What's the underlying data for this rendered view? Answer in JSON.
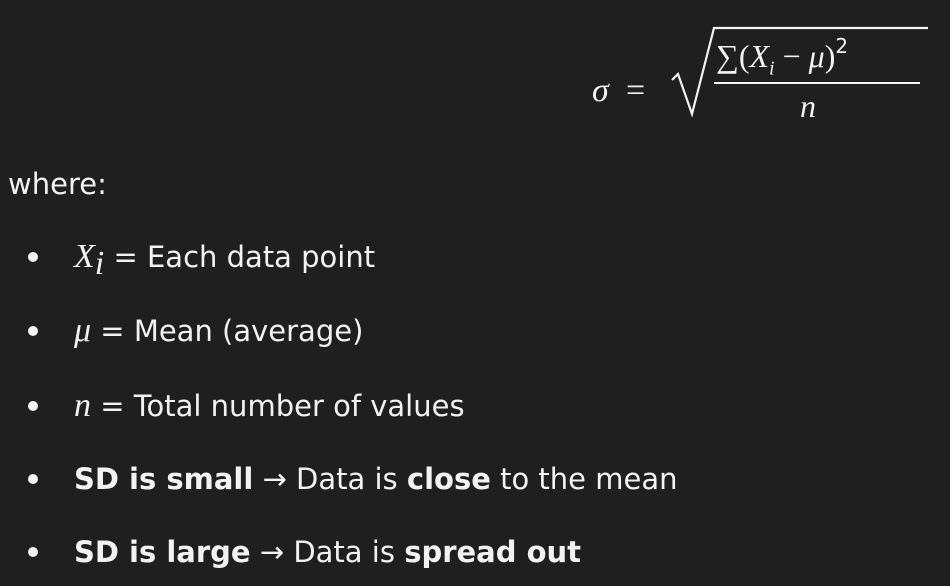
{
  "formula": {
    "lhs": "σ",
    "equals": "=",
    "numerator_sum": "∑(",
    "numerator_var": "X",
    "numerator_sub": "i",
    "numerator_minus": " − ",
    "numerator_mu": "μ",
    "numerator_close": ")",
    "numerator_sup": "2",
    "denominator": "n"
  },
  "intro": "where:",
  "definitions": [
    {
      "symbol": "X",
      "symbol_sub": "i",
      "text": " = Each data point"
    },
    {
      "symbol": "μ",
      "text": " = Mean (average)"
    },
    {
      "symbol": "n",
      "text": " = Total number of values"
    }
  ],
  "notes": [
    {
      "bold_1": "SD is small",
      "text_1": " → Data is ",
      "bold_2": "close",
      "text_2": " to the mean"
    },
    {
      "bold_1": "SD is large",
      "text_1": " → Data is ",
      "bold_2": "spread out"
    }
  ]
}
